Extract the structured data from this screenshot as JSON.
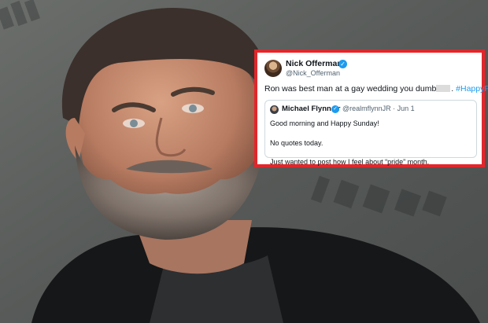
{
  "tweet": {
    "author_name": "Nick Offerman",
    "author_handle": "@Nick_Offerman",
    "text_before": "Ron was best man at a gay wedding you dumb",
    "text_after": ".",
    "hashtag": "#HappyPride",
    "quoted": {
      "author_name": "Michael Flynn Jr",
      "handle_and_date": "@realmflynnJR · Jun 1",
      "lines": [
        "Good morning and Happy Sunday!",
        "No quotes today.",
        "Just wanted to post how I feel about “pride” month."
      ]
    }
  },
  "colors": {
    "frame_border": "#e2262b",
    "verified": "#1d9bf0",
    "hashtag": "#1d9bf0"
  }
}
